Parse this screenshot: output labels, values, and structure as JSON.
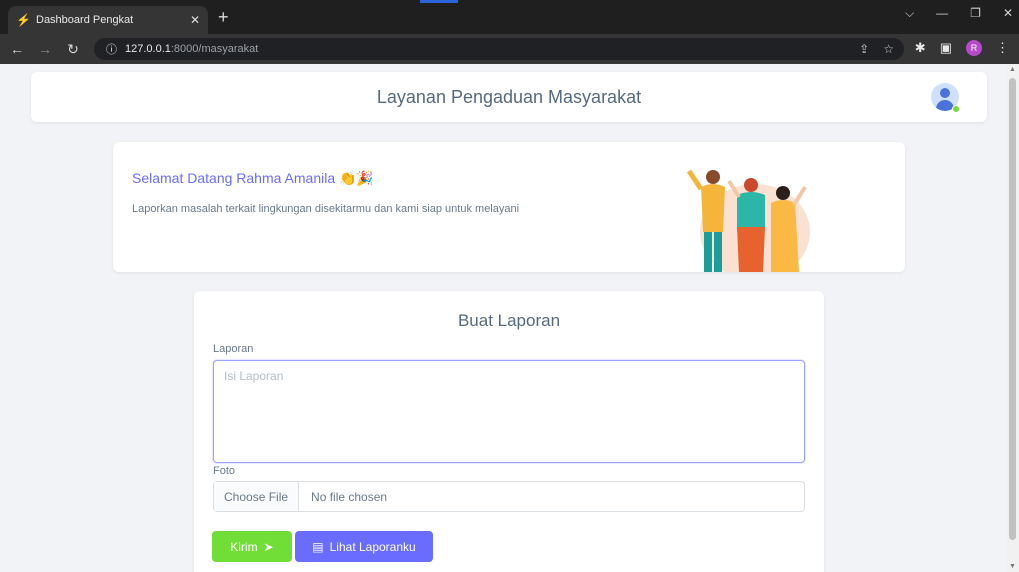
{
  "browser": {
    "tab_title": "Dashboard Pengkat",
    "url_host": "127.0.0.1",
    "url_path": ":8000/masyarakat",
    "profile_initial": "R"
  },
  "header": {
    "title": "Layanan Pengaduan Masyarakat"
  },
  "welcome": {
    "greeting": "Selamat Datang Rahma Amanila 👏🎉",
    "description": "Laporkan masalah terkait lingkungan disekitarmu dan kami siap untuk melayani"
  },
  "form": {
    "title": "Buat Laporan",
    "laporan_label": "Laporan",
    "laporan_placeholder": "Isi Laporan",
    "foto_label": "Foto",
    "choose_file_label": "Choose File",
    "no_file_text": "No file chosen",
    "kirim_label": "Kirim",
    "lihat_label": "Lihat Laporanku"
  },
  "colors": {
    "primary": "#696cff",
    "success": "#71dd37",
    "text": "#697a8d",
    "heading": "#566a7f"
  },
  "icons": [
    "lightning-favicon-icon",
    "close-icon",
    "plus-icon",
    "back-icon",
    "forward-icon",
    "reload-icon",
    "info-icon",
    "share-icon",
    "star-icon",
    "puzzle-icon",
    "sidebar-icon",
    "menu-icon",
    "send-icon",
    "document-icon"
  ]
}
